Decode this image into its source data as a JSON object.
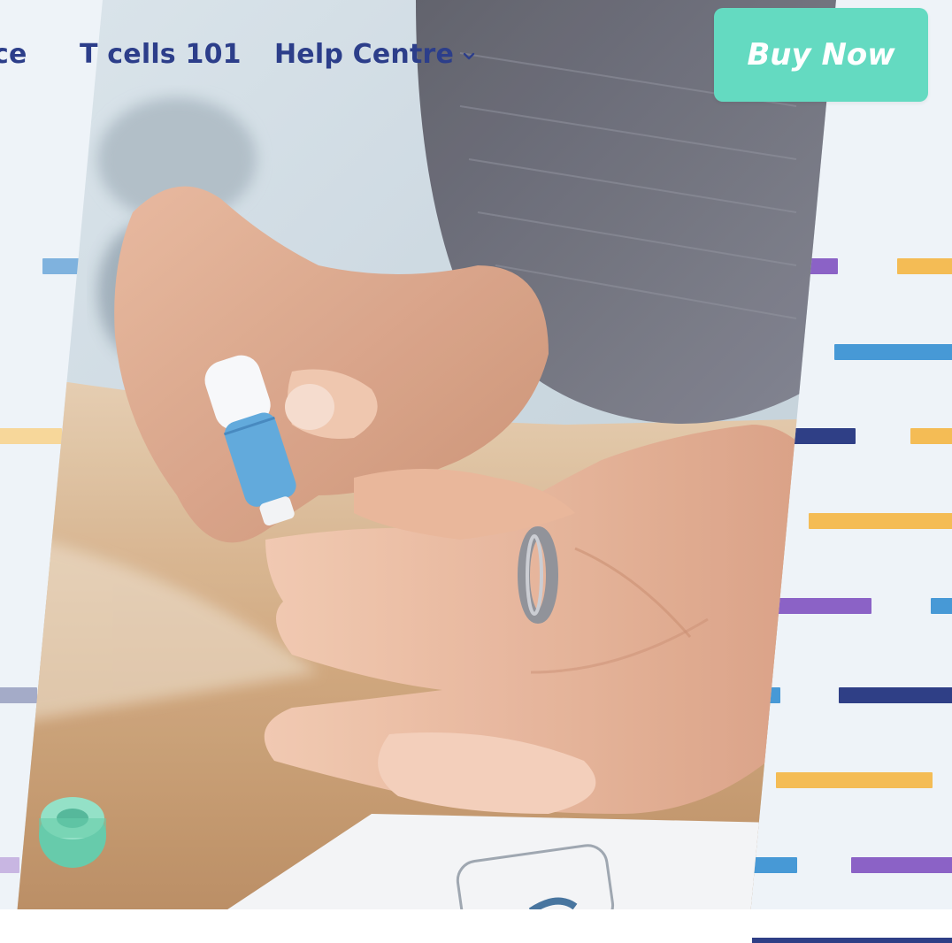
{
  "nav": {
    "prev_item_label": "ce",
    "t_cells_label": "T cells 101",
    "help_centre_label": "Help Centre"
  },
  "cta": {
    "buy_now_label": "Buy Now",
    "color": "#64dac1"
  },
  "icons": {
    "help_dropdown": "chevron-down-icon"
  },
  "colors": {
    "nav_text": "#2c3e8a",
    "background": "#eef3f8",
    "stripe_purple": "#8b62c6",
    "stripe_orange": "#f4bc55",
    "stripe_blue": "#4799d6",
    "stripe_navy": "#2f3f86"
  },
  "hero_image": {
    "subject": "hands-lancet-finger-prick-photo"
  }
}
